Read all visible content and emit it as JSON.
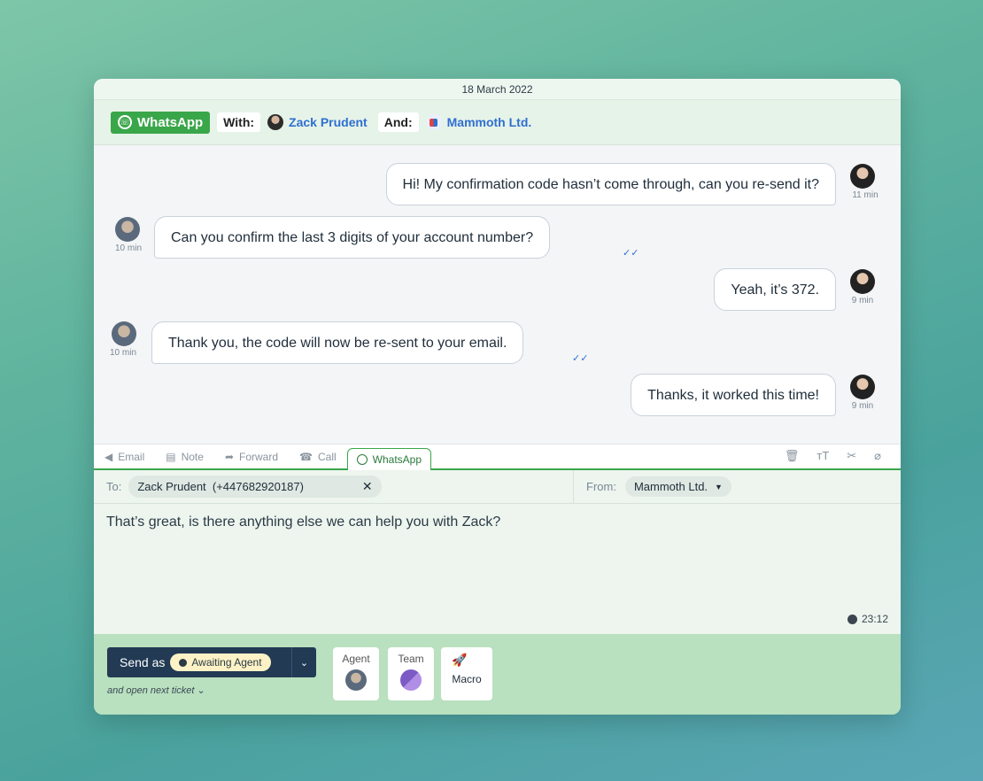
{
  "date": "18 March 2022",
  "header": {
    "channel": "WhatsApp",
    "with_label": "With:",
    "contact": "Zack Prudent",
    "and_label": "And:",
    "company": "Mammoth Ltd."
  },
  "messages": [
    {
      "side": "right",
      "text": "Hi! My confirmation code hasn’t come through, can you re-send it?",
      "time": "11 min"
    },
    {
      "side": "left",
      "text": "Can you confirm the last 3 digits of your account number?",
      "time": "10 min"
    },
    {
      "side": "right",
      "text": "Yeah, it’s 372.",
      "time": "9 min"
    },
    {
      "side": "left",
      "text": "Thank you, the code will now be re-sent to your email.",
      "time": "10 min"
    },
    {
      "side": "right",
      "text": "Thanks, it worked this time!",
      "time": "9 min"
    }
  ],
  "tabs": [
    {
      "label": "Email",
      "icon": "send-icon"
    },
    {
      "label": "Note",
      "icon": "note-icon"
    },
    {
      "label": "Forward",
      "icon": "forward-icon"
    },
    {
      "label": "Call",
      "icon": "phone-icon"
    },
    {
      "label": "WhatsApp",
      "icon": "whatsapp-icon",
      "active": true
    }
  ],
  "compose": {
    "to_label": "To:",
    "to_value": "Zack Prudent  (+447682920187)",
    "from_label": "From:",
    "from_value": "Mammoth Ltd.",
    "text": "That’s great, is there anything else we can help you with Zack?",
    "time": "23:12"
  },
  "footer": {
    "send_label": "Send as",
    "status": "Awaiting Agent",
    "next_ticket": "and open next ticket",
    "agent_label": "Agent",
    "team_label": "Team",
    "macro_label": "Macro"
  },
  "colors": {
    "whatsapp_green": "#3aa64a",
    "send_button": "#223a54",
    "footer_bg": "#b9e0bf",
    "link_blue": "#2f6fd1"
  }
}
